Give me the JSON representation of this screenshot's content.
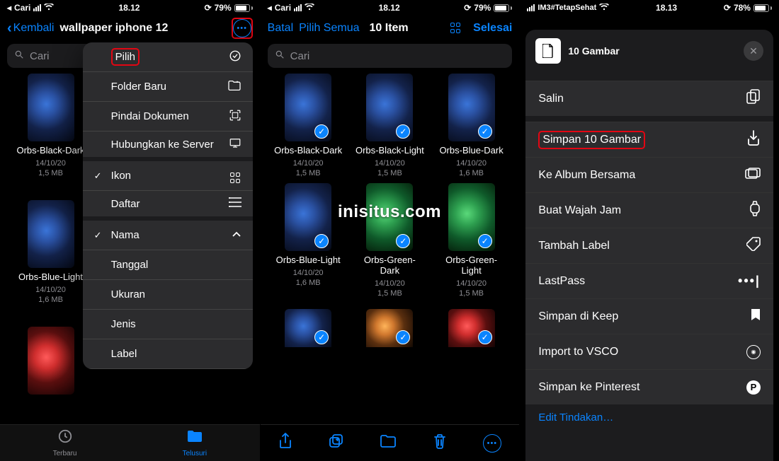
{
  "watermark": "inisitus.com",
  "phone1": {
    "status": {
      "back": "Cari",
      "time": "18.12",
      "battery": "79%"
    },
    "nav": {
      "back": "Kembali",
      "title": "wallpaper iphone 12"
    },
    "search_placeholder": "Cari",
    "files": [
      {
        "name": "Orbs-Black-Dark",
        "date": "14/10/20",
        "size": "1,5 MB",
        "variant": ""
      },
      {
        "name": "Orbs-Blue-Light",
        "date": "14/10/20",
        "size": "1,6 MB",
        "variant": ""
      }
    ],
    "menu": [
      {
        "label": "Pilih",
        "icon": "select",
        "highlight": true
      },
      {
        "label": "Folder Baru",
        "icon": "folder"
      },
      {
        "label": "Pindai Dokumen",
        "icon": "scan"
      },
      {
        "label": "Hubungkan ke Server",
        "icon": "server",
        "sep": true
      },
      {
        "label": "Ikon",
        "icon": "grid",
        "checked": true
      },
      {
        "label": "Daftar",
        "icon": "list",
        "sep": true
      },
      {
        "label": "Nama",
        "icon": "chevron",
        "checked": true
      },
      {
        "label": "Tanggal",
        "icon": ""
      },
      {
        "label": "Ukuran",
        "icon": ""
      },
      {
        "label": "Jenis",
        "icon": ""
      },
      {
        "label": "Label",
        "icon": ""
      }
    ],
    "tabs": [
      {
        "label": "Terbaru",
        "active": false
      },
      {
        "label": "Telusuri",
        "active": true
      }
    ]
  },
  "phone2": {
    "status": {
      "back": "Cari",
      "time": "18.12",
      "battery": "79%"
    },
    "nav": {
      "cancel": "Batal",
      "selectall": "Pilih Semua",
      "count": "10 Item",
      "done": "Selesai"
    },
    "search_placeholder": "Cari",
    "files": [
      {
        "name": "Orbs-Black-Dark",
        "date": "14/10/20",
        "size": "1,5 MB",
        "variant": ""
      },
      {
        "name": "Orbs-Black-Light",
        "date": "14/10/20",
        "size": "1,5 MB",
        "variant": ""
      },
      {
        "name": "Orbs-Blue-Dark",
        "date": "14/10/20",
        "size": "1,6 MB",
        "variant": ""
      },
      {
        "name": "Orbs-Blue-Light",
        "date": "14/10/20",
        "size": "1,6 MB",
        "variant": ""
      },
      {
        "name": "Orbs-Green-Dark",
        "date": "14/10/20",
        "size": "1,5 MB",
        "variant": "green"
      },
      {
        "name": "Orbs-Green-Light",
        "date": "14/10/20",
        "size": "1,5 MB",
        "variant": "green"
      }
    ],
    "bottom_files": [
      {
        "variant": ""
      },
      {
        "variant": "orange"
      },
      {
        "variant": "red"
      }
    ],
    "toolbar_icons": [
      "share",
      "duplicate",
      "move",
      "trash",
      "more"
    ]
  },
  "phone3": {
    "status": {
      "carrier": "IM3#TetapSehat",
      "time": "18.13",
      "battery": "78%"
    },
    "sheet": {
      "title": "10 Gambar",
      "group1": [
        {
          "label": "Salin",
          "icon": "copy"
        }
      ],
      "group2": [
        {
          "label": "Simpan 10 Gambar",
          "icon": "save",
          "highlight": true
        },
        {
          "label": "Ke Album Bersama",
          "icon": "album"
        },
        {
          "label": "Buat Wajah Jam",
          "icon": "watch"
        },
        {
          "label": "Tambah Label",
          "icon": "tag"
        },
        {
          "label": "LastPass",
          "icon": "lastpass"
        },
        {
          "label": "Simpan di Keep",
          "icon": "keep"
        },
        {
          "label": "Import to VSCO",
          "icon": "vsco"
        },
        {
          "label": "Simpan ke Pinterest",
          "icon": "pinterest"
        }
      ],
      "edit": "Edit Tindakan…"
    }
  }
}
